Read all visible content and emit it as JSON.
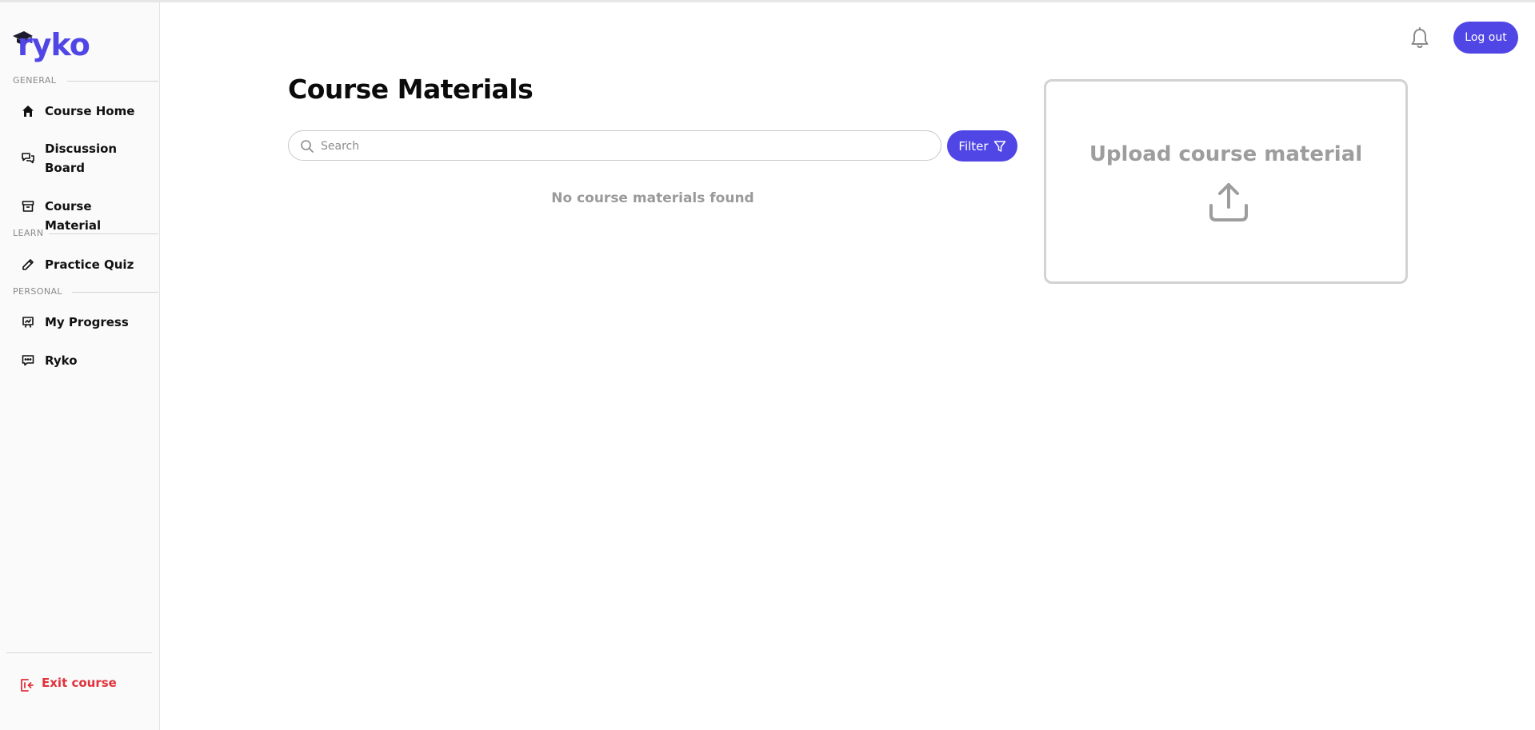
{
  "app": {
    "logo_text": "ryko",
    "brand_color": "#4f46e5",
    "danger_color": "#e0323c"
  },
  "sidebar": {
    "sections": [
      {
        "label": "GENERAL"
      },
      {
        "label": "LEARN"
      },
      {
        "label": "PERSONAL"
      }
    ],
    "items": [
      {
        "label": "Course Home",
        "icon": "home-icon"
      },
      {
        "label": "Discussion Board",
        "line1": "Discussion",
        "line2": "Board",
        "icon": "chat-bubbles-icon"
      },
      {
        "label": "Course Material",
        "icon": "archive-box-icon"
      },
      {
        "label": "Practice Quiz",
        "icon": "pencil-icon"
      },
      {
        "label": "My Progress",
        "icon": "presentation-chart-icon"
      },
      {
        "label": "Ryko",
        "icon": "chat-dots-icon"
      }
    ],
    "exit": {
      "label": "Exit course",
      "icon": "exit-icon"
    }
  },
  "header": {
    "notifications_icon": "bell-icon",
    "logout_label": "Log out"
  },
  "main": {
    "title": "Course Materials",
    "search": {
      "placeholder": "Search",
      "value": ""
    },
    "filter_label": "Filter",
    "empty_message": "No course materials found",
    "upload": {
      "label": "Upload course material",
      "icon": "upload-icon"
    }
  }
}
